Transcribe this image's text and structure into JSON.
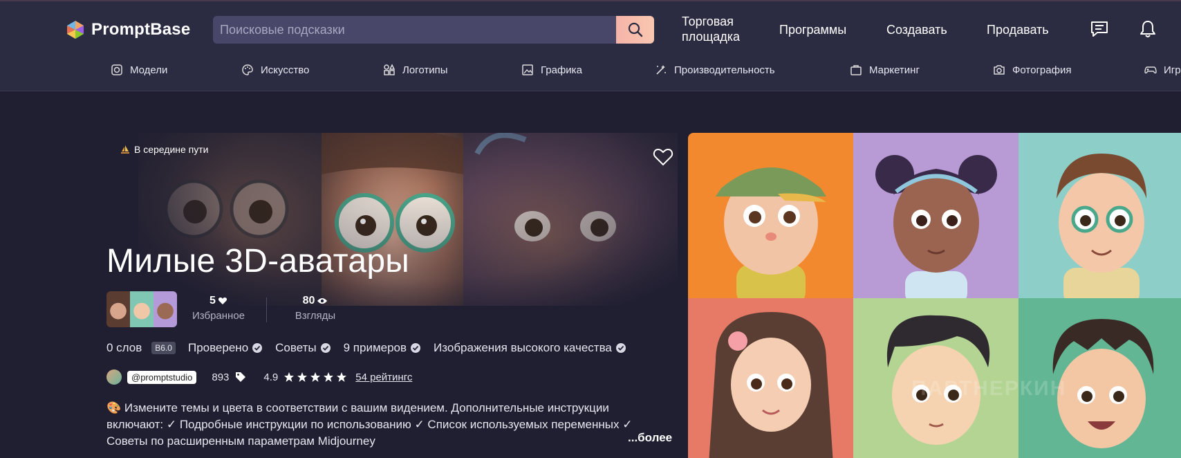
{
  "header": {
    "logo_text": "PromptBase",
    "search_placeholder": "Поисковые подсказки",
    "nav": {
      "marketplace_line1": "Торговая",
      "marketplace_line2": "площадка",
      "programs": "Программы",
      "create": "Создавать",
      "sell": "Продавать"
    }
  },
  "categories": [
    {
      "label": "Модели",
      "icon": "models-icon"
    },
    {
      "label": "Искусство",
      "icon": "palette-icon"
    },
    {
      "label": "Логотипы",
      "icon": "shapes-icon"
    },
    {
      "label": "Графика",
      "icon": "image-icon"
    },
    {
      "label": "Производительность",
      "icon": "magic-wand-icon"
    },
    {
      "label": "Маркетинг",
      "icon": "briefcase-icon"
    },
    {
      "label": "Фотография",
      "icon": "camera-icon"
    },
    {
      "label": "Игр",
      "icon": "gamepad-icon"
    }
  ],
  "product": {
    "model_badge": "В середине пути",
    "title": "Милые 3D-аватары",
    "favorites": {
      "value": "5",
      "label": "Избранное"
    },
    "views": {
      "value": "80",
      "label": "Взгляды"
    },
    "features": {
      "words": "0 слов",
      "version": "B6.0",
      "verified": "Проверено",
      "tips": "Советы",
      "examples": "9 примеров",
      "hq": "Изображения высокого качества"
    },
    "seller": {
      "handle": "@promptstudio",
      "sales": "893",
      "rating": "4.9",
      "ratings_link": "54 рейтингс"
    },
    "description_lines": [
      "Измените темы и цвета в соответствии с вашим видением. Дополнительные инструкции",
      "включают: ✓ Подробные инструкции по использованию ✓ Список используемых переменных ✓",
      "Советы по расширенным параметрам Midjourney"
    ],
    "more_label": "...более"
  },
  "watermark": "ПАРТНЕРКИН",
  "colors": {
    "background": "#201f31",
    "header": "#2b2b42",
    "search_button": "#f6b4a8"
  }
}
